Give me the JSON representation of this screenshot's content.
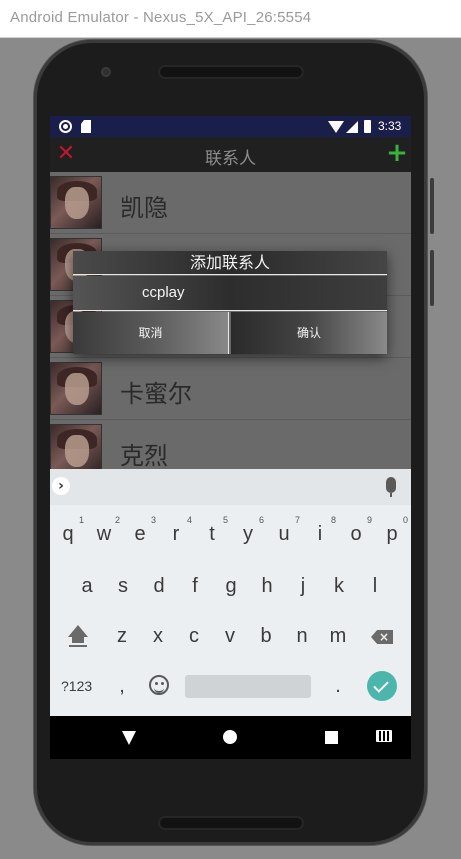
{
  "window": {
    "title": "Android Emulator - Nexus_5X_API_26:5554"
  },
  "status_bar": {
    "time": "3:33"
  },
  "app_bar": {
    "title": "联系人",
    "close_icon": "close-icon",
    "add_icon": "add-icon",
    "close_color": "#c0162e",
    "add_color": "#39b13c"
  },
  "contacts": [
    {
      "name": "凯隐"
    },
    {
      "name": ""
    },
    {
      "name": ""
    },
    {
      "name": "卡蜜尔"
    },
    {
      "name": "克烈"
    }
  ],
  "dialog": {
    "title": "添加联系人",
    "input_value": "ccplay",
    "cancel_label": "取消",
    "confirm_label": "确认"
  },
  "keyboard": {
    "row1": [
      "q",
      "w",
      "e",
      "r",
      "t",
      "y",
      "u",
      "i",
      "o",
      "p"
    ],
    "row1_hints": [
      "1",
      "2",
      "3",
      "4",
      "5",
      "6",
      "7",
      "8",
      "9",
      "0"
    ],
    "row2": [
      "a",
      "s",
      "d",
      "f",
      "g",
      "h",
      "j",
      "k",
      "l"
    ],
    "row3": [
      "z",
      "x",
      "c",
      "v",
      "b",
      "n",
      "m"
    ],
    "symbols_label": "?123",
    "comma": ",",
    "period": ".",
    "enter_color": "#4db6ac"
  }
}
